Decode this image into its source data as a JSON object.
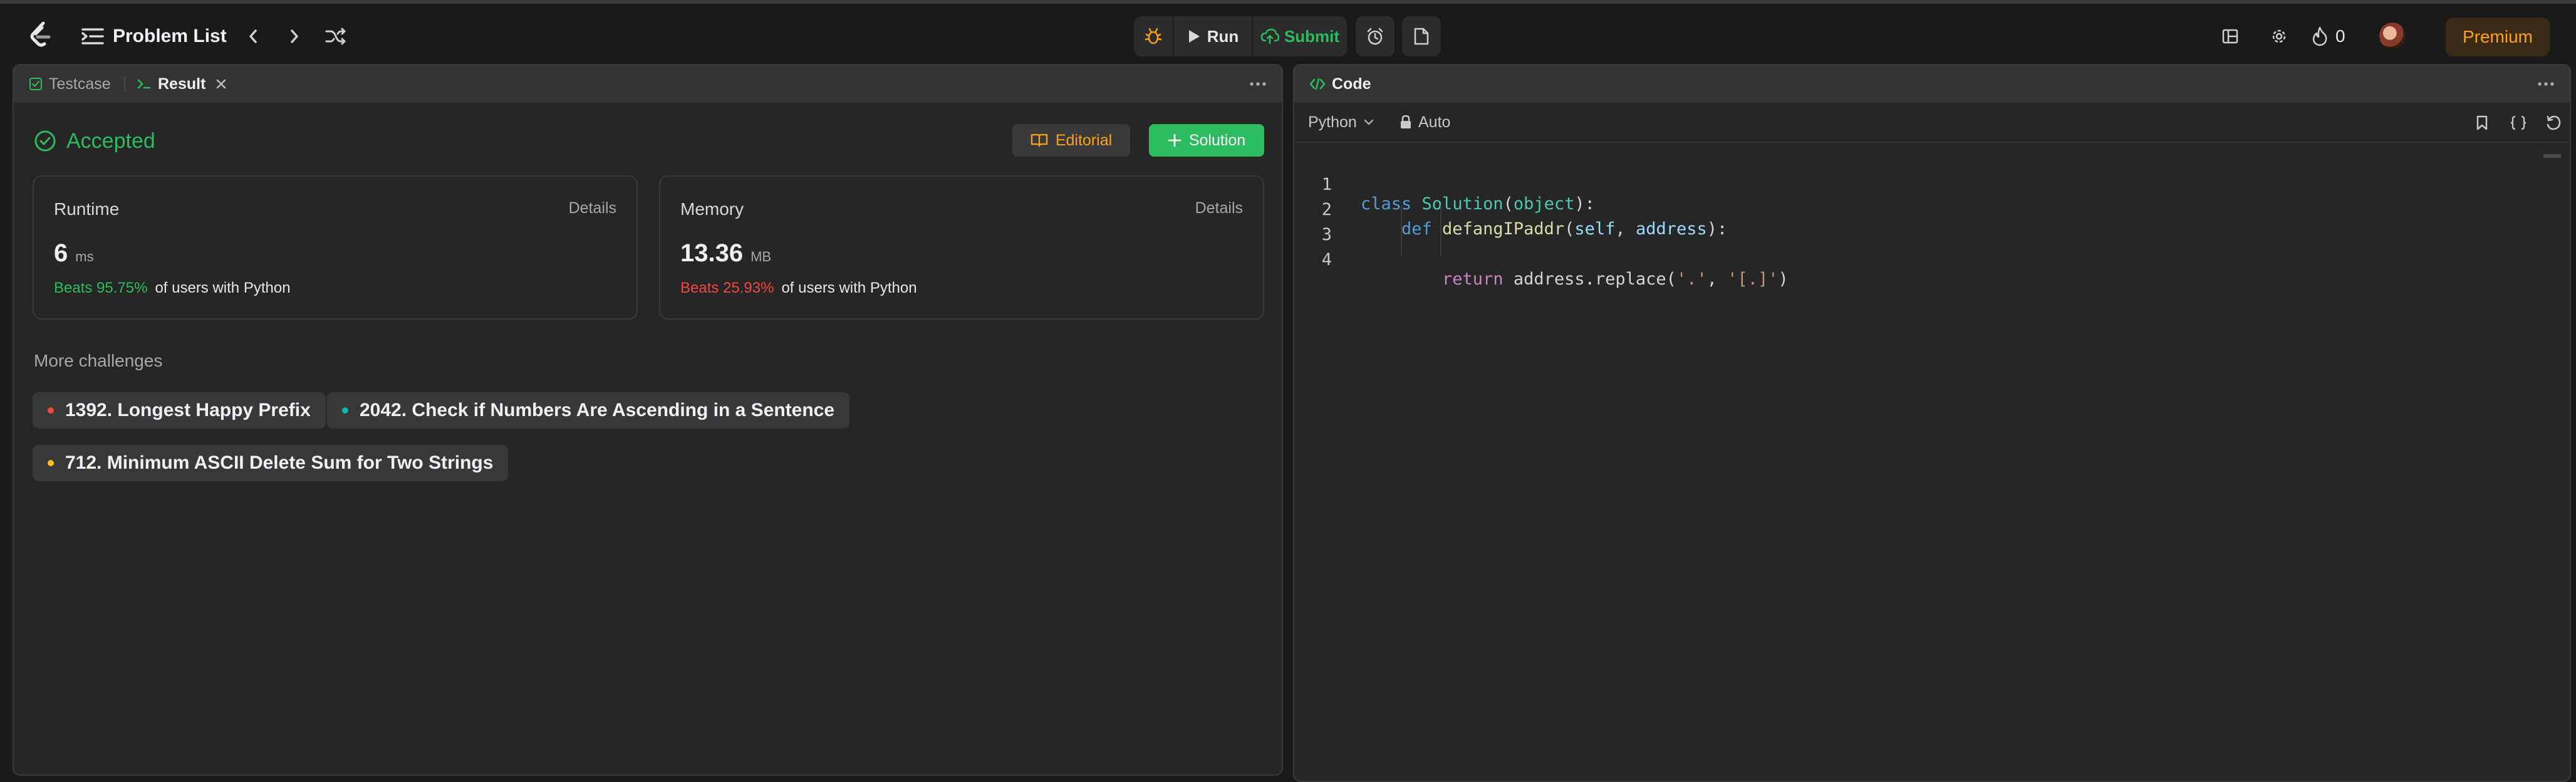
{
  "colors": {
    "accent_green": "#2cbb5d",
    "easy": "#00b8a3",
    "medium": "#ffc01e",
    "hard": "#ef4743",
    "premium": "#ffa116"
  },
  "topbar": {
    "problem_list_label": "Problem List",
    "run_label": "Run",
    "submit_label": "Submit",
    "streak_count": "0",
    "premium_label": "Premium"
  },
  "left_panel": {
    "tabs": [
      {
        "label": "Testcase",
        "active": false
      },
      {
        "label": "Result",
        "active": true
      }
    ],
    "status": "Accepted",
    "editorial_label": "Editorial",
    "solution_label": "Solution",
    "runtime": {
      "title": "Runtime",
      "details_label": "Details",
      "value": "6",
      "unit": "ms",
      "beats": "Beats 95.75%",
      "suffix": "of users with Python"
    },
    "memory": {
      "title": "Memory",
      "details_label": "Details",
      "value": "13.36",
      "unit": "MB",
      "beats": "Beats 25.93%",
      "suffix": "of users with Python"
    },
    "more_challenges_title": "More challenges",
    "challenges": [
      {
        "title": "1392. Longest Happy Prefix",
        "difficulty": "hard"
      },
      {
        "title": "2042. Check if Numbers Are Ascending in a Sentence",
        "difficulty": "easy"
      },
      {
        "title": "712. Minimum ASCII Delete Sum for Two Strings",
        "difficulty": "medium"
      }
    ]
  },
  "code_panel": {
    "tab_label": "Code",
    "language": "Python",
    "auto_label": "Auto",
    "lines": [
      {
        "num": "1",
        "tokens": [
          {
            "t": "class ",
            "c": "#569cd6"
          },
          {
            "t": "Solution",
            "c": "#4ec9b0"
          },
          {
            "t": "(",
            "c": "#d4d4d4"
          },
          {
            "t": "object",
            "c": "#4ec9b0"
          },
          {
            "t": "):",
            "c": "#d4d4d4"
          }
        ]
      },
      {
        "num": "2",
        "tokens": [
          {
            "t": "    def ",
            "c": "#569cd6"
          },
          {
            "t": "defangIPaddr",
            "c": "#dcdcaa"
          },
          {
            "t": "(",
            "c": "#d4d4d4"
          },
          {
            "t": "self",
            "c": "#9cdcfe"
          },
          {
            "t": ", ",
            "c": "#d4d4d4"
          },
          {
            "t": "address",
            "c": "#9cdcfe"
          },
          {
            "t": "):",
            "c": "#d4d4d4"
          }
        ]
      },
      {
        "num": "3",
        "tokens": []
      },
      {
        "num": "4",
        "tokens": [
          {
            "t": "        return ",
            "c": "#c586c0"
          },
          {
            "t": "address",
            "c": "#d4d4d4"
          },
          {
            "t": ".replace(",
            "c": "#d4d4d4"
          },
          {
            "t": "'.'",
            "c": "#ce9178"
          },
          {
            "t": ", ",
            "c": "#d4d4d4"
          },
          {
            "t": "'[.]'",
            "c": "#ce9178"
          },
          {
            "t": ")",
            "c": "#d4d4d4"
          }
        ]
      }
    ]
  }
}
